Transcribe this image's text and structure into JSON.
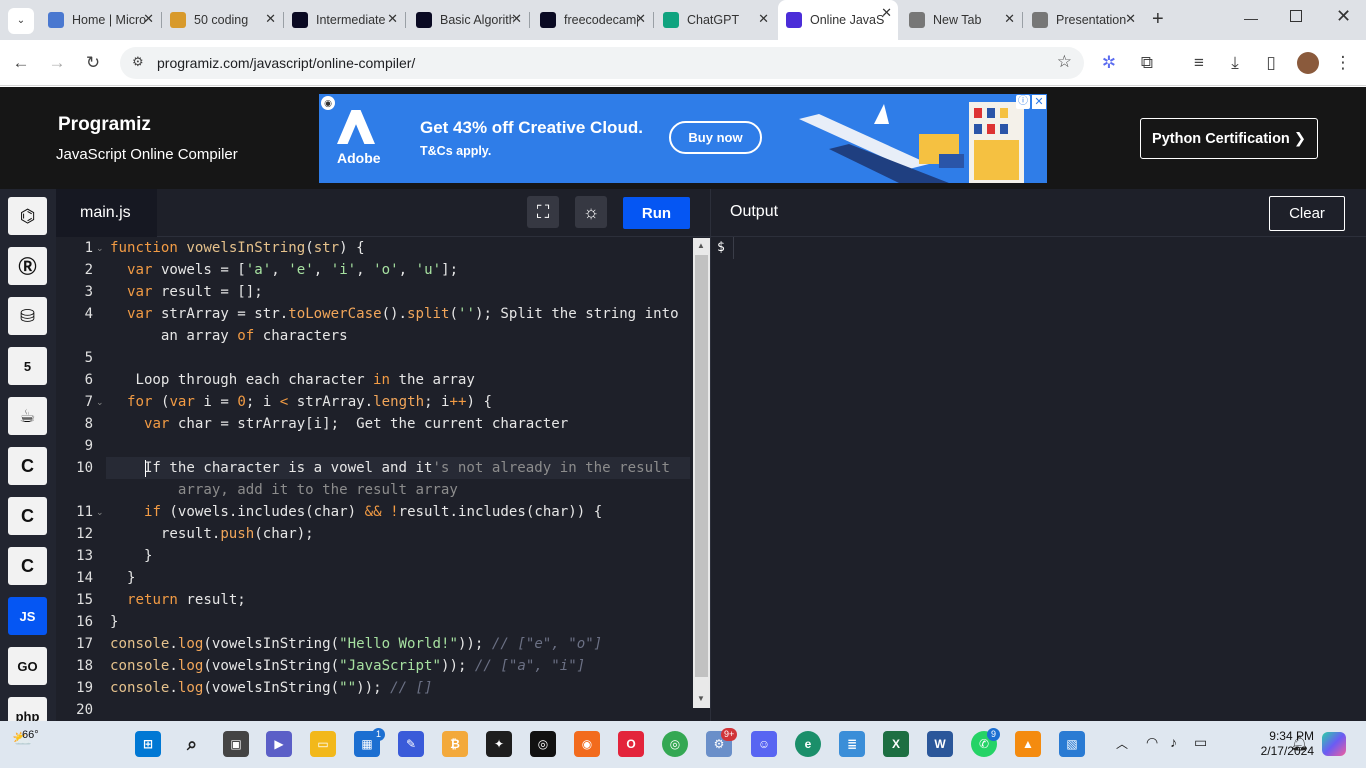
{
  "browser": {
    "tabs": [
      {
        "title": "Home | Microsoft",
        "icon": "microsoft-icon",
        "color": "#4a78d0"
      },
      {
        "title": "50 coding",
        "icon": "photo-icon",
        "color": "#d89a2c"
      },
      {
        "title": "Intermediate",
        "icon": "freecodecamp-icon",
        "color": "#0a0a23"
      },
      {
        "title": "Basic Algorithm",
        "icon": "freecodecamp-icon",
        "color": "#0a0a23"
      },
      {
        "title": "freecodecamp",
        "icon": "freecodecamp-icon",
        "color": "#0a0a23"
      },
      {
        "title": "ChatGPT",
        "icon": "chatgpt-icon",
        "color": "#10a37f"
      },
      {
        "title": "Online JavaScript",
        "icon": "programiz-icon",
        "color": "#4b2dd8",
        "active": true
      },
      {
        "title": "New Tab",
        "icon": "globe-icon",
        "color": "#777777"
      },
      {
        "title": "Presentation",
        "icon": "globe-icon",
        "color": "#777777"
      }
    ],
    "url": "programiz.com/javascript/online-compiler/"
  },
  "header": {
    "logo": "Programiz",
    "subtitle": "JavaScript Online Compiler",
    "ad": {
      "brand": "Adobe",
      "headline": "Get 43% off Creative Cloud.",
      "terms": "T&Cs apply.",
      "cta": "Buy now"
    },
    "certification": "Python Certification ❯"
  },
  "rail": [
    {
      "name": "python",
      "icon": "python-icon",
      "label": "Py"
    },
    {
      "name": "r",
      "icon": "r-icon",
      "label": "R"
    },
    {
      "name": "sql",
      "icon": "database-icon",
      "label": "SQL"
    },
    {
      "name": "html",
      "icon": "html5-icon",
      "label": "5"
    },
    {
      "name": "java",
      "icon": "java-icon",
      "label": "J"
    },
    {
      "name": "c",
      "icon": "c-icon",
      "label": "C"
    },
    {
      "name": "cpp",
      "icon": "cpp-icon",
      "label": "C++"
    },
    {
      "name": "csharp",
      "icon": "csharp-icon",
      "label": "C#"
    },
    {
      "name": "js",
      "icon": "js-icon",
      "label": "JS",
      "active": true
    },
    {
      "name": "go",
      "icon": "go-icon",
      "label": "GO"
    },
    {
      "name": "php",
      "icon": "php-icon",
      "label": "php"
    }
  ],
  "editor": {
    "filename": "main.js",
    "run_label": "Run",
    "line_numbers": [
      "1",
      "2",
      "3",
      "4",
      "",
      "5",
      "6",
      "7",
      "8",
      "9",
      "10",
      "",
      "11",
      "12",
      "13",
      "14",
      "15",
      "16",
      "17",
      "18",
      "19",
      "20"
    ]
  },
  "output": {
    "title": "Output",
    "clear_label": "Clear",
    "prompt": "$"
  },
  "taskbar": {
    "weather": "66°",
    "time": "9:34 PM",
    "date": "2/17/2024",
    "badges": {
      "store": "1",
      "teams": "9+",
      "whatsapp": "9"
    }
  }
}
